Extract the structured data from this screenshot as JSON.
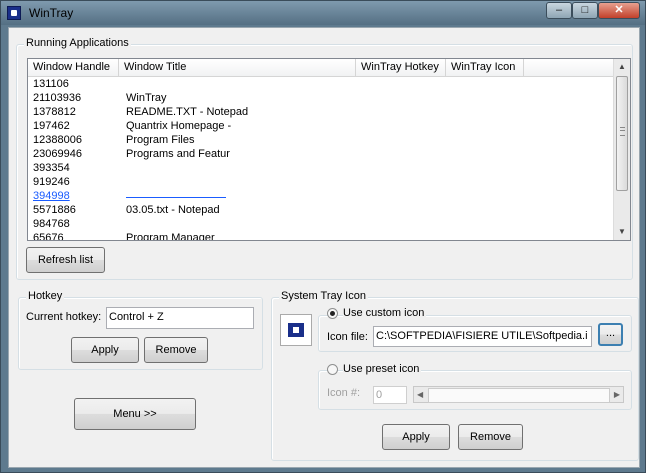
{
  "window": {
    "title": "WinTray"
  },
  "running_apps": {
    "group_title": "Running Applications",
    "columns": [
      "Window Handle",
      "Window Title",
      "WinTray Hotkey",
      "WinTray Icon"
    ],
    "rows": [
      {
        "handle": "131106",
        "title": ""
      },
      {
        "handle": "21103936",
        "title": "WinTray"
      },
      {
        "handle": "1378812",
        "title": "README.TXT - Notepad"
      },
      {
        "handle": "197462",
        "title": "Quantrix Homepage -"
      },
      {
        "handle": "12388006",
        "title": "Program Files"
      },
      {
        "handle": "23069946",
        "title": "Programs and Featur"
      },
      {
        "handle": "393354",
        "title": ""
      },
      {
        "handle": "919246",
        "title": ""
      },
      {
        "handle": "394998",
        "title": ""
      },
      {
        "handle": "5571886",
        "title": "03.05.txt - Notepad"
      },
      {
        "handle": "984768",
        "title": ""
      },
      {
        "handle": "65676",
        "title": "Program Manager"
      }
    ],
    "refresh_label": "Refresh list"
  },
  "hotkey": {
    "group_title": "Hotkey",
    "current_label": "Current hotkey:",
    "value": "Control + Z",
    "apply_label": "Apply",
    "remove_label": "Remove"
  },
  "menu_label": "Menu >>",
  "tray_icon": {
    "group_title": "System Tray Icon",
    "custom_label": "Use custom icon",
    "icon_file_label": "Icon file:",
    "icon_file_value": "C:\\SOFTPEDIA\\FISIERE UTILE\\Softpedia.i",
    "browse_label": "...",
    "preset_label": "Use preset icon",
    "icon_num_label": "Icon #:",
    "icon_num_value": "0",
    "apply_label": "Apply",
    "remove_label": "Remove"
  }
}
